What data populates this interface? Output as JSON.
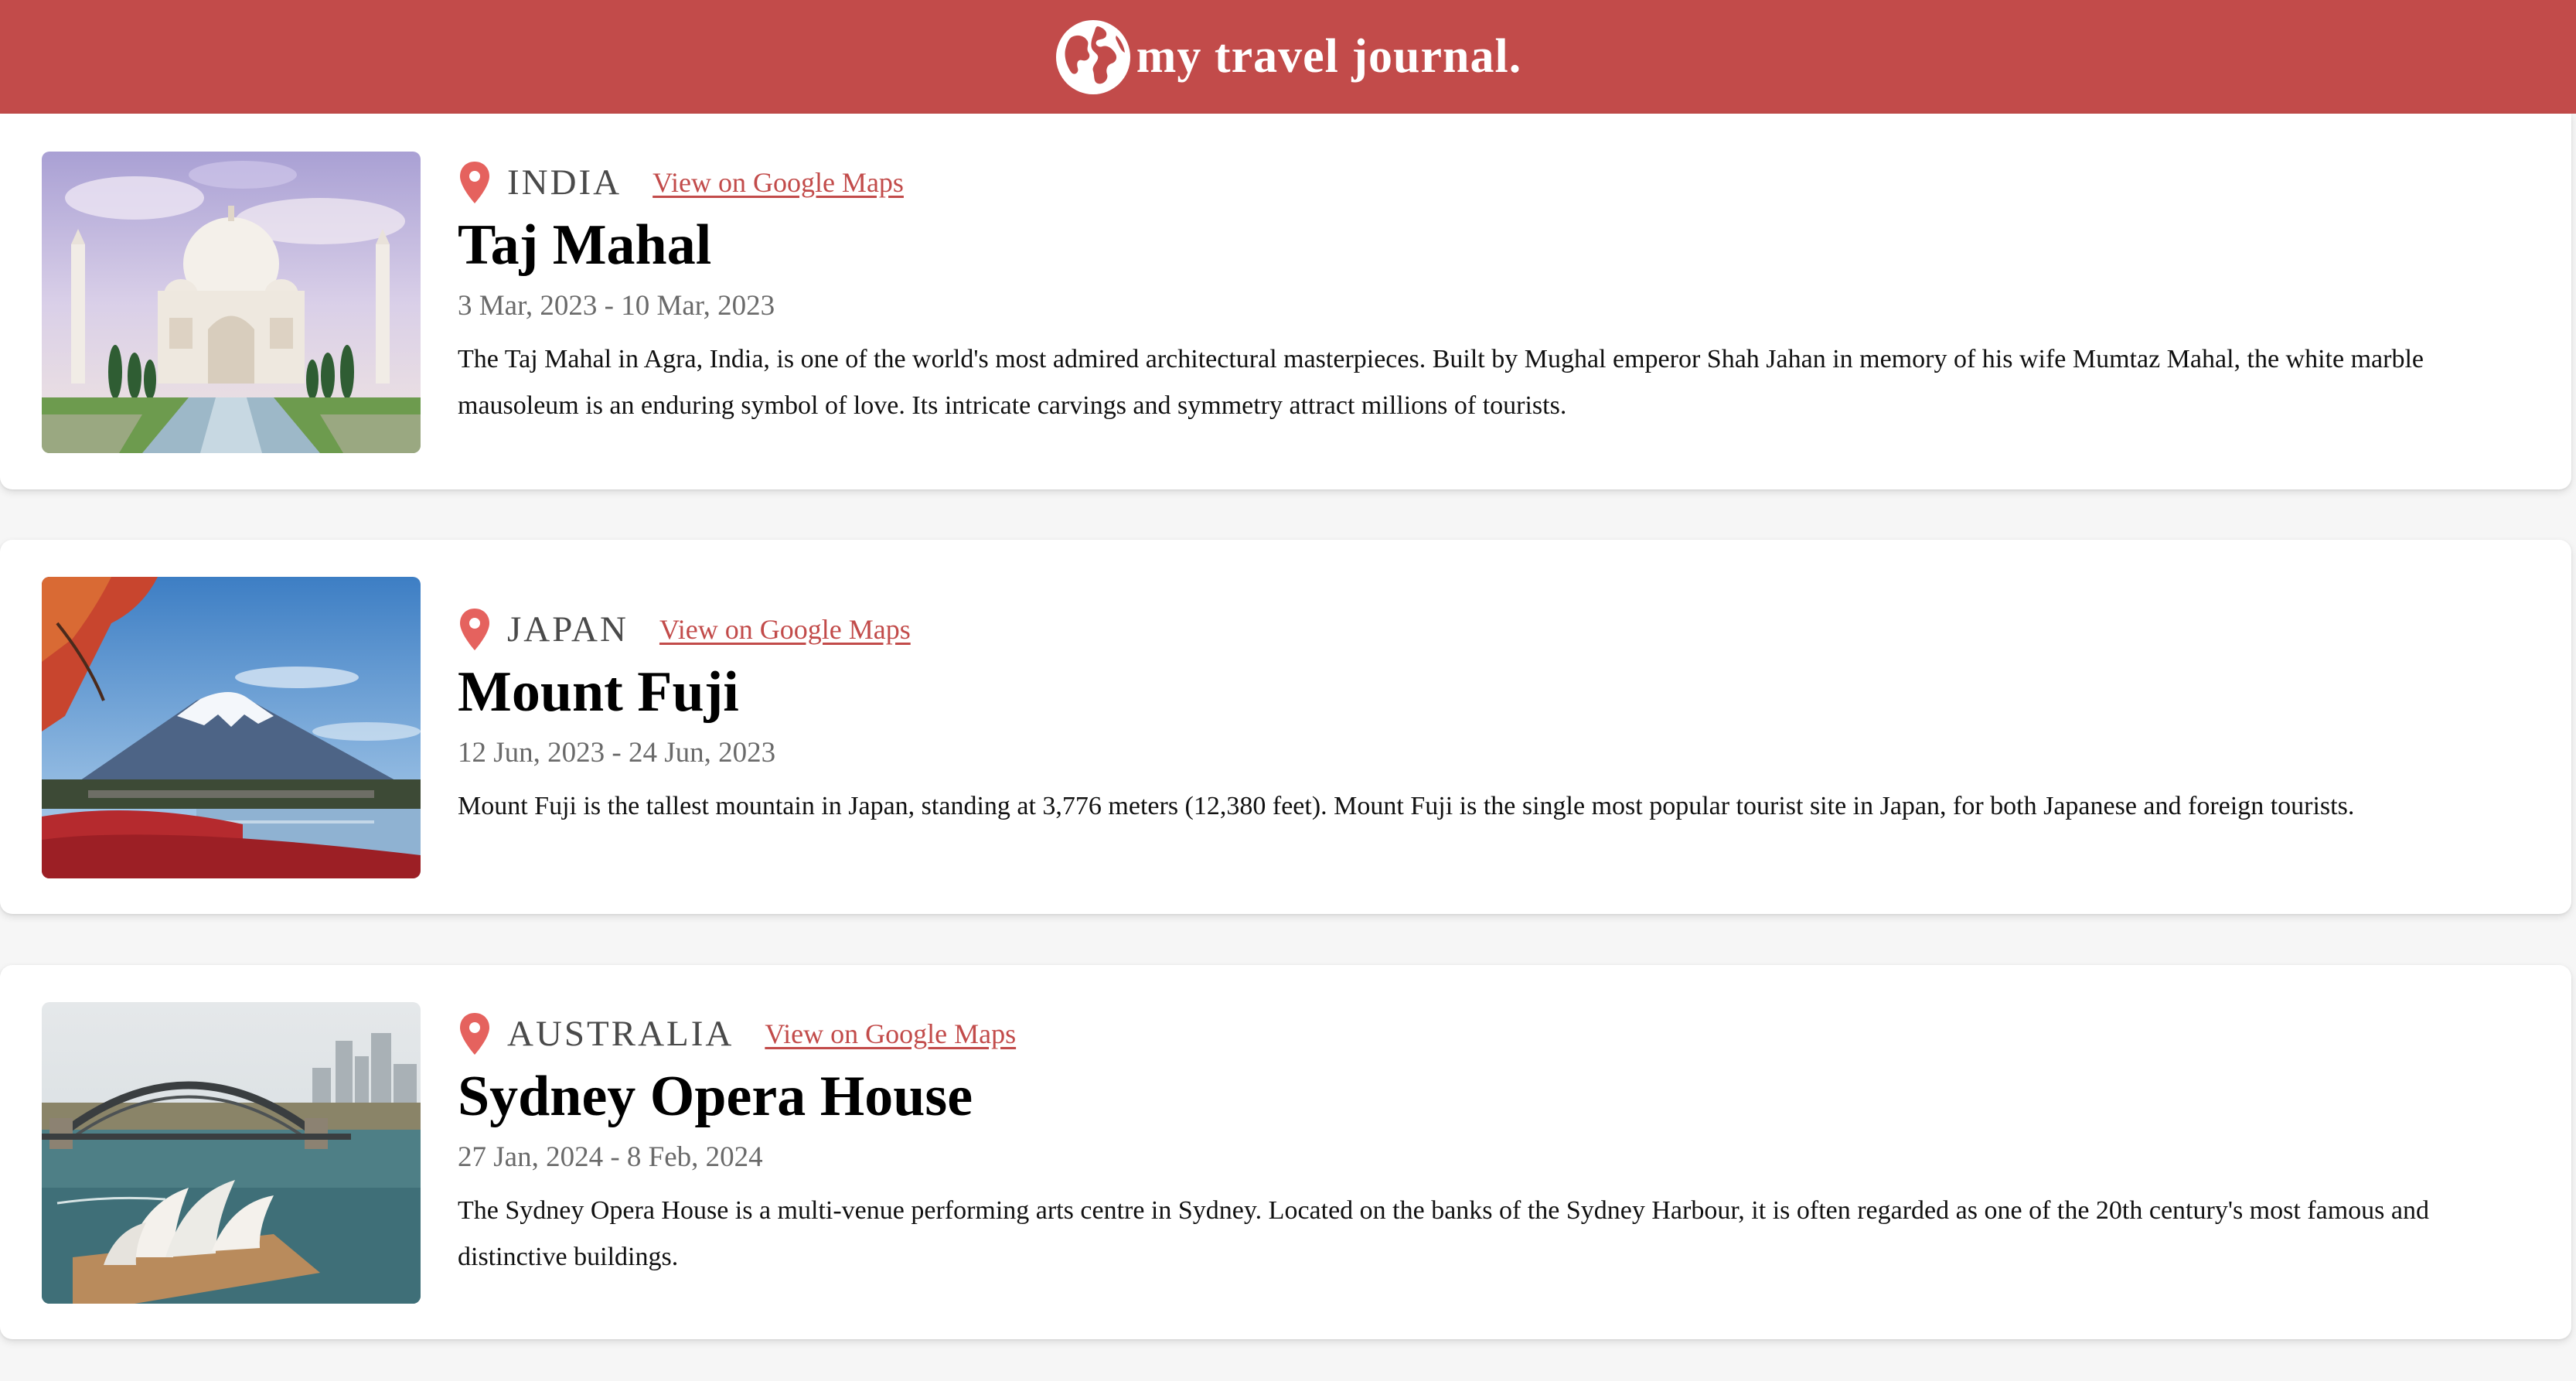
{
  "header": {
    "title": "my travel journal.",
    "logo_icon": "globe-icon",
    "background": "#c24b4a"
  },
  "accent_color": "#c24b4a",
  "entries": [
    {
      "country": "INDIA",
      "map_link": "View on Google Maps",
      "place": "Taj Mahal",
      "dates": "3 Mar, 2023 - 10 Mar, 2023",
      "description": "The Taj Mahal in Agra, India, is one of the world's most admired architectural masterpieces. Built by Mughal emperor Shah Jahan in memory of his wife Mumtaz Mahal, the white marble mausoleum is an enduring symbol of love. Its intricate carvings and symmetry attract millions of tourists.",
      "icon": "location-pin-icon"
    },
    {
      "country": "JAPAN",
      "map_link": "View on Google Maps",
      "place": "Mount Fuji",
      "dates": "12 Jun, 2023 - 24 Jun, 2023",
      "description": "Mount Fuji is the tallest mountain in Japan, standing at 3,776 meters (12,380 feet). Mount Fuji is the single most popular tourist site in Japan, for both Japanese and foreign tourists.",
      "icon": "location-pin-icon"
    },
    {
      "country": "AUSTRALIA",
      "map_link": "View on Google Maps",
      "place": "Sydney Opera House",
      "dates": "27 Jan, 2024 - 8 Feb, 2024",
      "description": "The Sydney Opera House is a multi-venue performing arts centre in Sydney. Located on the banks of the Sydney Harbour, it is often regarded as one of the 20th century's most famous and distinctive buildings.",
      "icon": "location-pin-icon"
    }
  ]
}
